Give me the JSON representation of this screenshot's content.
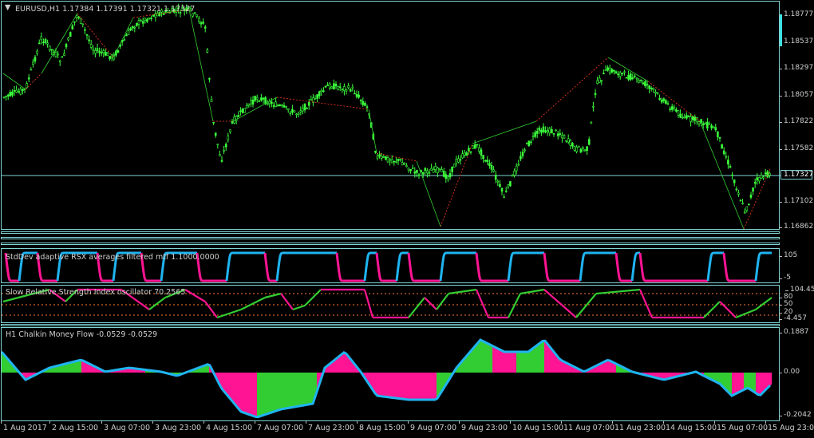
{
  "main": {
    "title": "EURUSD,H1  1.17384 1.17391 1.17321 1.17327",
    "menu_glyph": "▼",
    "price_ticks": [
      "1.18777",
      "1.18537",
      "1.18297",
      "1.18057",
      "1.17822",
      "1.17582",
      "1.17342",
      "1.17102",
      "1.16862"
    ],
    "current_price": "1.17327"
  },
  "ind1": {
    "title": "StdDev adaptive RSX averages filtered mtf 1.1000.0000",
    "ticks": [
      "105",
      "-5"
    ]
  },
  "ind2": {
    "title": "Slow Relative Strength Index oscillator 70.2565",
    "ticks": [
      "104.456",
      "80",
      "50",
      "20",
      "-4.457"
    ]
  },
  "ind3": {
    "title": "H1 Chalkin Money Flow -0.0529 -0.0529",
    "ticks": [
      "0.1887",
      "0.00",
      "-0.2042"
    ]
  },
  "time_axis": [
    "1 Aug 2017",
    "2 Aug 15:00",
    "3 Aug 07:00",
    "3 Aug 23:00",
    "4 Aug 15:00",
    "7 Aug 07:00",
    "7 Aug 23:00",
    "8 Aug 15:00",
    "9 Aug 07:00",
    "9 Aug 23:00",
    "10 Aug 15:00",
    "11 Aug 07:00",
    "11 Aug 23:00",
    "14 Aug 15:00",
    "15 Aug 07:00",
    "15 Aug 23:00"
  ],
  "colors": {
    "bull": "#32cd32",
    "bear": "#ff1493",
    "rsx_up": "#1fb4f0",
    "frame": "#7fd3d3",
    "zigzag": "#ff3b1f"
  }
}
